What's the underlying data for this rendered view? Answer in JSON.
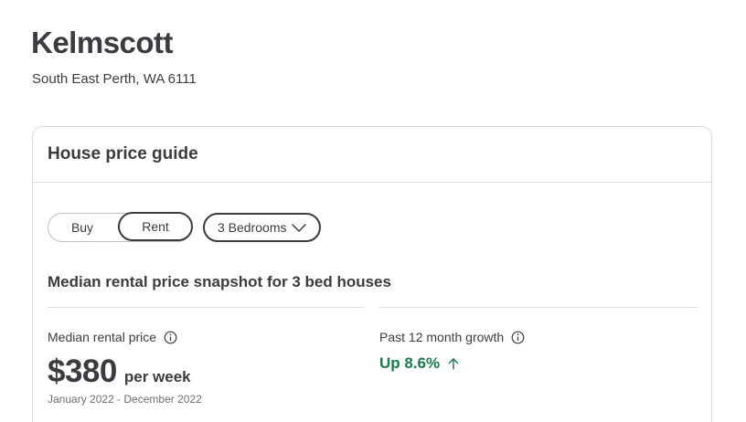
{
  "suburb": {
    "name": "Kelmscott",
    "location": "South East Perth, WA 6111"
  },
  "price_guide": {
    "title": "House price guide",
    "toggle": {
      "options": [
        "Buy",
        "Rent"
      ],
      "selected": "Rent"
    },
    "bedrooms_dropdown": {
      "value": "3 Bedrooms",
      "icon": "chevron-down-icon"
    },
    "snapshot_title": "Median rental price snapshot for 3 bed houses",
    "median": {
      "label": "Median rental price",
      "value": "$380",
      "unit": "per week",
      "period": "January 2022 - December 2022",
      "icon": "info-icon"
    },
    "growth": {
      "label": "Past 12 month growth",
      "value": "Up 8.6%",
      "icon": "arrow-up-icon",
      "color": "#1a7a48"
    }
  }
}
